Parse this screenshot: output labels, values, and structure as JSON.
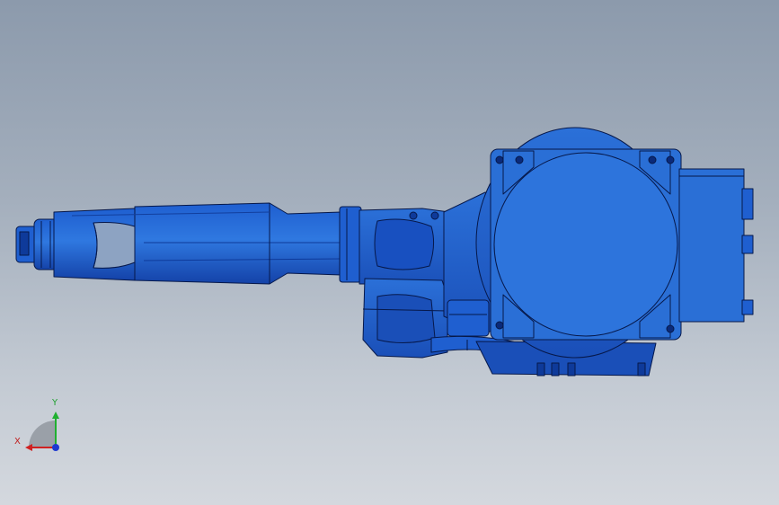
{
  "viewport": {
    "background_top": "#8c9aac",
    "background_bottom": "#d4d8de"
  },
  "model": {
    "color_main": "#2a6fd6",
    "color_dark": "#0e3a9a",
    "color_edge": "#06184a"
  },
  "triad": {
    "x_label": "X",
    "y_label": "Y",
    "x_color": "#d02020",
    "y_color": "#20b030",
    "z_color": "#1e3ad0"
  }
}
